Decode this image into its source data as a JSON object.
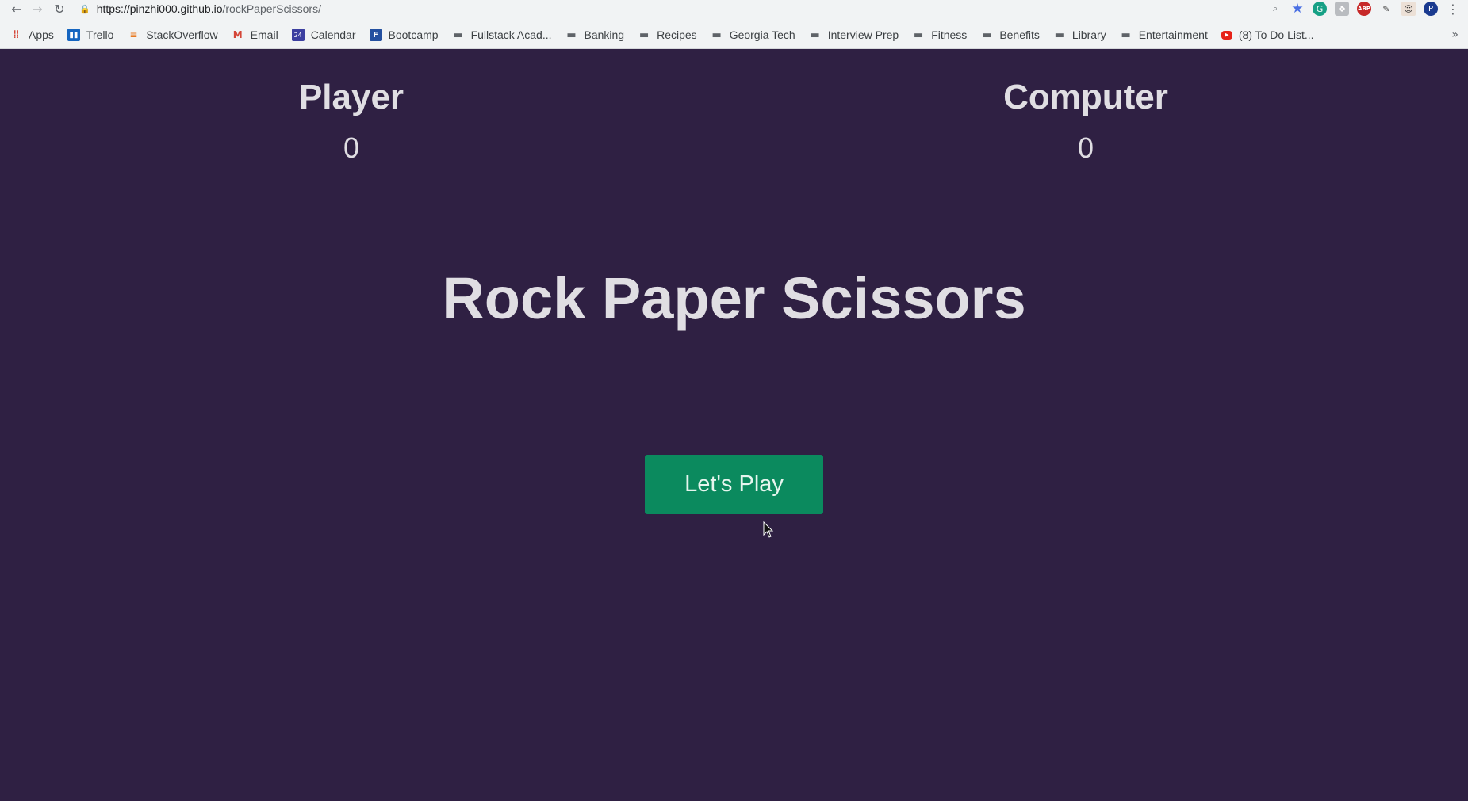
{
  "browser": {
    "url_host": "https://pinzhi000.github.io",
    "url_path": "/rockPaperScissors/",
    "bookmarks": [
      {
        "label": "Apps",
        "icon": "apps-grid-icon"
      },
      {
        "label": "Trello",
        "icon": "trello-icon"
      },
      {
        "label": "StackOverflow",
        "icon": "stackoverflow-icon"
      },
      {
        "label": "Email",
        "icon": "gmail-icon"
      },
      {
        "label": "Calendar",
        "icon": "calendar-icon"
      },
      {
        "label": "Bootcamp",
        "icon": "bootcamp-icon"
      },
      {
        "label": "Fullstack Acad...",
        "icon": "folder-icon"
      },
      {
        "label": "Banking",
        "icon": "folder-icon"
      },
      {
        "label": "Recipes",
        "icon": "folder-icon"
      },
      {
        "label": "Georgia Tech",
        "icon": "folder-icon"
      },
      {
        "label": "Interview Prep",
        "icon": "folder-icon"
      },
      {
        "label": "Fitness",
        "icon": "folder-icon"
      },
      {
        "label": "Benefits",
        "icon": "folder-icon"
      },
      {
        "label": "Library",
        "icon": "folder-icon"
      },
      {
        "label": "Entertainment",
        "icon": "folder-icon"
      },
      {
        "label": "(8) To Do List...",
        "icon": "youtube-icon"
      }
    ]
  },
  "game": {
    "title": "Rock Paper Scissors",
    "player": {
      "label": "Player",
      "score": "0"
    },
    "computer": {
      "label": "Computer",
      "score": "0"
    },
    "play_button": "Let's Play"
  },
  "colors": {
    "background": "#2f2043",
    "text": "#e0dee3",
    "button": "#0b8a5e"
  }
}
